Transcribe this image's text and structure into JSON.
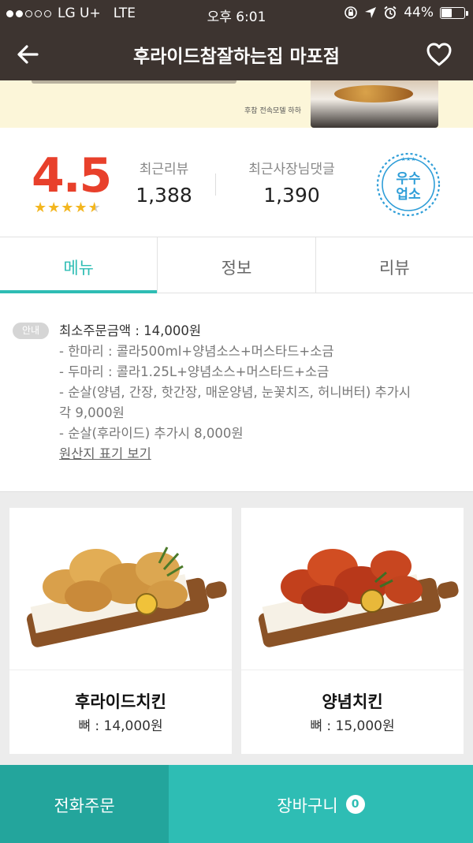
{
  "status_bar": {
    "carrier": "LG U+",
    "network": "LTE",
    "time": "오후 6:01",
    "battery": "44%",
    "battery_level": 0.44
  },
  "nav": {
    "title": "후라이드참잘하는집 마포점",
    "back_icon": "arrow-left-icon",
    "favorite_icon": "heart-outline-icon"
  },
  "banner": {
    "caption": "후참 전속모델 하하"
  },
  "stats": {
    "rating": "4.5",
    "stars_value": 4.5,
    "recent_reviews_label": "최근리뷰",
    "recent_reviews_value": "1,388",
    "owner_replies_label": "최근사장님댓글",
    "owner_replies_value": "1,390",
    "badge_line1": "우수",
    "badge_line2": "업소"
  },
  "tabs": [
    {
      "label": "메뉴",
      "active": true
    },
    {
      "label": "정보",
      "active": false
    },
    {
      "label": "리뷰",
      "active": false
    }
  ],
  "info": {
    "pill": "안내",
    "min_order": "최소주문금액 : 14,000원",
    "line1": "- 한마리 : 콜라500ml+양념소스+머스타드+소금",
    "line2": "- 두마리 : 콜라1.25L+양념소스+머스타드+소금",
    "line3a": "- 순살(양념, 간장, 핫간장, 매운양념, 눈꽃치즈, 허니버터) 추가시",
    "line3b": "각 9,000원",
    "line4": "- 순살(후라이드) 추가시 8,000원",
    "origin_link": "원산지 표기 보기"
  },
  "menu_items": [
    {
      "name": "후라이드치킨",
      "price": "뼈 : 14,000원"
    },
    {
      "name": "양념치킨",
      "price": "뼈 : 15,000원"
    }
  ],
  "bottom": {
    "call_label": "전화주문",
    "cart_label": "장바구니",
    "cart_count": "0"
  },
  "colors": {
    "header": "#3d3430",
    "accent": "#2ebdb4",
    "accent_dark": "#23a59c",
    "rating": "#e8402b",
    "star": "#f3b61f"
  }
}
